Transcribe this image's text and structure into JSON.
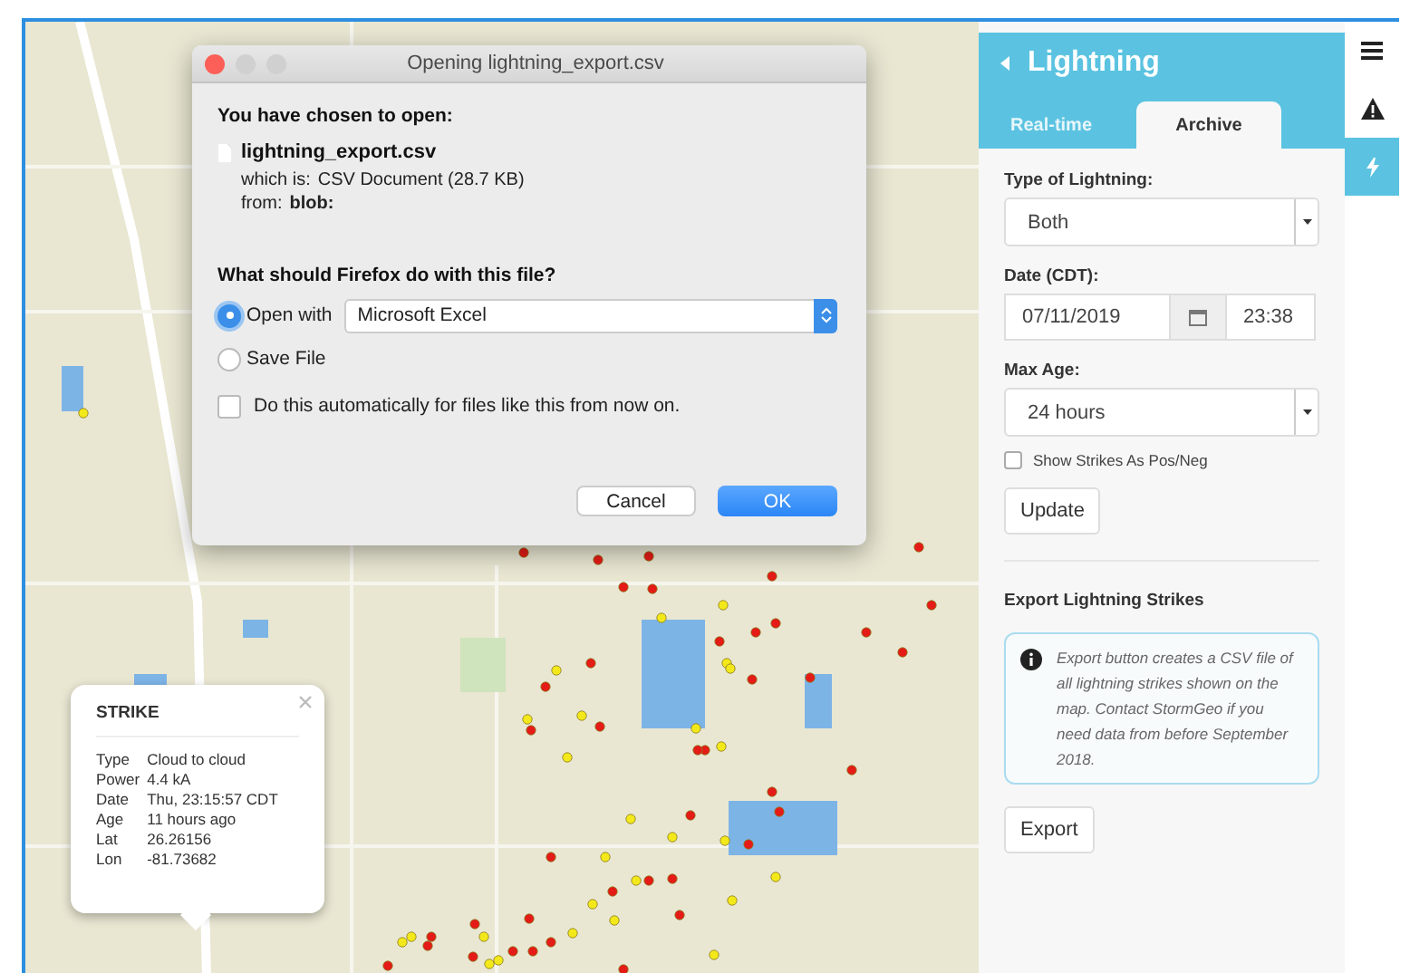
{
  "dialog": {
    "title": "Opening lightning_export.csv",
    "heading": "You have chosen to open:",
    "file_name": "lightning_export.csv",
    "type_label": "which is:",
    "type_value": "CSV Document (28.7 KB)",
    "from_label": "from:",
    "from_value": "blob:",
    "question": "What should Firefox do with this file?",
    "options": [
      {
        "label": "Open with",
        "selected": true,
        "app": "Microsoft Excel"
      },
      {
        "label": "Save File",
        "selected": false
      }
    ],
    "auto_checkbox": {
      "label": "Do this automatically for files like this from now on.",
      "checked": false
    },
    "buttons": [
      {
        "label": "Cancel",
        "kind": "default"
      },
      {
        "label": "OK",
        "kind": "primary"
      }
    ]
  },
  "popup": {
    "title": "STRIKE",
    "rows": [
      {
        "label": "Type",
        "value": "Cloud to cloud"
      },
      {
        "label": "Power",
        "value": "4.4 kA"
      },
      {
        "label": "Date",
        "value": "Thu, 23:15:57 CDT"
      },
      {
        "label": "Age",
        "value": "11 hours ago"
      },
      {
        "label": "Lat",
        "value": "26.26156"
      },
      {
        "label": "Lon",
        "value": "-81.73682"
      }
    ]
  },
  "panel": {
    "title": "Lightning",
    "tabs": [
      {
        "label": "Real-time",
        "selected": false
      },
      {
        "label": "Archive",
        "selected": true
      }
    ],
    "type_label": "Type of Lightning:",
    "type_value": "Both",
    "date_label": "Date (CDT):",
    "date_value": "07/11/2019",
    "time_value": "23:38",
    "max_age_label": "Max Age:",
    "max_age_value": "24 hours",
    "pos_neg_checkbox": {
      "label": "Show Strikes As Pos/Neg",
      "checked": false
    },
    "update_button": "Update",
    "export_heading": "Export Lightning Strikes",
    "info_text": "Export button creates a CSV file of all lightning strikes shown on the map. Contact StormGeo if you need data from before September 2018.",
    "export_button": "Export"
  },
  "rail": [
    {
      "kind": "menu",
      "selected": false
    },
    {
      "kind": "warning",
      "selected": false
    },
    {
      "kind": "lightning",
      "selected": true
    }
  ]
}
